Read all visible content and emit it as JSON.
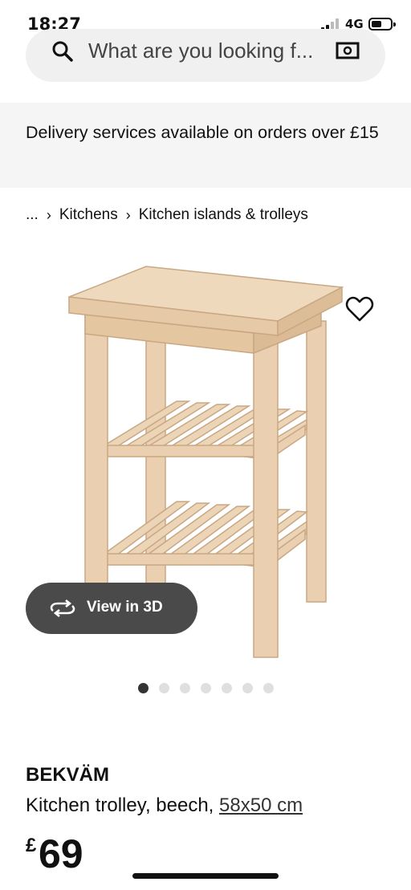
{
  "status_bar": {
    "time": "18:27",
    "network": "4G",
    "signal_icon": "cellular-signal-icon",
    "battery_icon": "battery-icon"
  },
  "search": {
    "placeholder": "What are you looking f...",
    "search_icon": "search-icon",
    "camera_icon": "camera-icon"
  },
  "banner": {
    "text": "Delivery services available on orders over £15"
  },
  "breadcrumb": {
    "ellipsis": "...",
    "items": [
      "Kitchens",
      "Kitchen islands & trolleys"
    ]
  },
  "product": {
    "image_icon": "product-photo",
    "favourite_icon": "heart-icon",
    "view3d_label": "View in 3D",
    "view3d_icon": "rotate-3d-icon",
    "carousel": {
      "total": 7,
      "active_index": 0
    },
    "name": "BEKVÄM",
    "description": "Kitchen trolley, beech, ",
    "size": "58x50 cm",
    "currency": "£",
    "price": "69"
  },
  "colors": {
    "search_bg": "#f0f0f0",
    "banner_bg": "#f5f5f5",
    "view3d_bg": "#4a4a4a",
    "dot_active": "#333333",
    "dot_inactive": "#dfdfdf",
    "wood": "#e8ccaa"
  }
}
